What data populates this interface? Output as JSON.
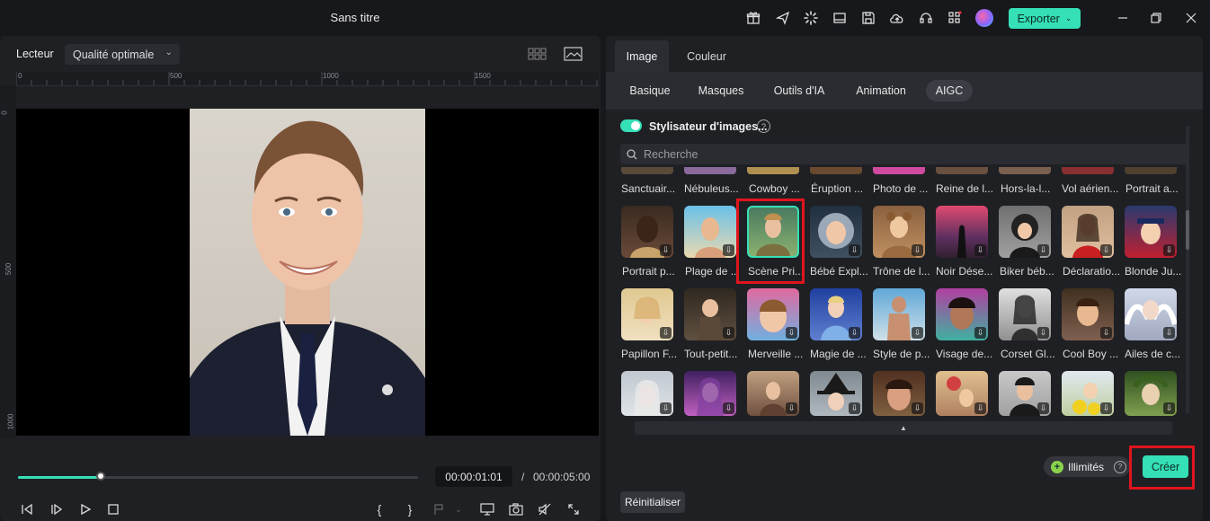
{
  "window": {
    "title": "Sans titre",
    "export_label": "Exporter",
    "toolbar_icons": [
      "gift-icon",
      "send-icon",
      "loading-icon",
      "layout-icon",
      "save-icon",
      "cloud-upload-icon",
      "headset-icon",
      "apps-icon",
      "avatar-icon"
    ]
  },
  "player": {
    "label": "Lecteur",
    "quality": "Qualité optimale",
    "ruler_top": [
      "0",
      "500",
      "1000",
      "1500"
    ],
    "ruler_left": [
      "0",
      "500",
      "1000"
    ],
    "current_time": "00:00:01:01",
    "separator": "/",
    "total_time": "00:00:05:00",
    "progress": 0.21
  },
  "panel": {
    "tabs": [
      "Image",
      "Couleur"
    ],
    "subtabs": [
      "Basique",
      "Masques",
      "Outils d'IA",
      "Animation",
      "AIGC"
    ],
    "active_subtab": "AIGC",
    "stylizer_title": "Stylisateur d'images...",
    "search_placeholder": "Recherche",
    "row0_labels": [
      "Sanctuair...",
      "Nébuleus...",
      "Cowboy ...",
      "Éruption ...",
      "Photo de ...",
      "Reine de l...",
      "Hors-la-l...",
      "Vol aérien...",
      "Portrait a..."
    ],
    "row1_labels": [
      "Portrait p...",
      "Plage de ...",
      "Scène Pri...",
      "Bébé Expl...",
      "Trône de l...",
      "Noir Dése...",
      "Biker béb...",
      "Déclaratio...",
      "Blonde Ju..."
    ],
    "row2_labels": [
      "Papillon F...",
      "Tout-petit...",
      "Merveille ...",
      "Magie de ...",
      "Style de p...",
      "Visage de...",
      "Corset Gl...",
      "Cool Boy ...",
      "Ailes de c..."
    ],
    "illimites_label": "Illimités",
    "create_label": "Créer",
    "reset_label": "Réinitialiser"
  },
  "colors": {
    "accent": "#35e0b7",
    "highlight": "#e0141e"
  }
}
